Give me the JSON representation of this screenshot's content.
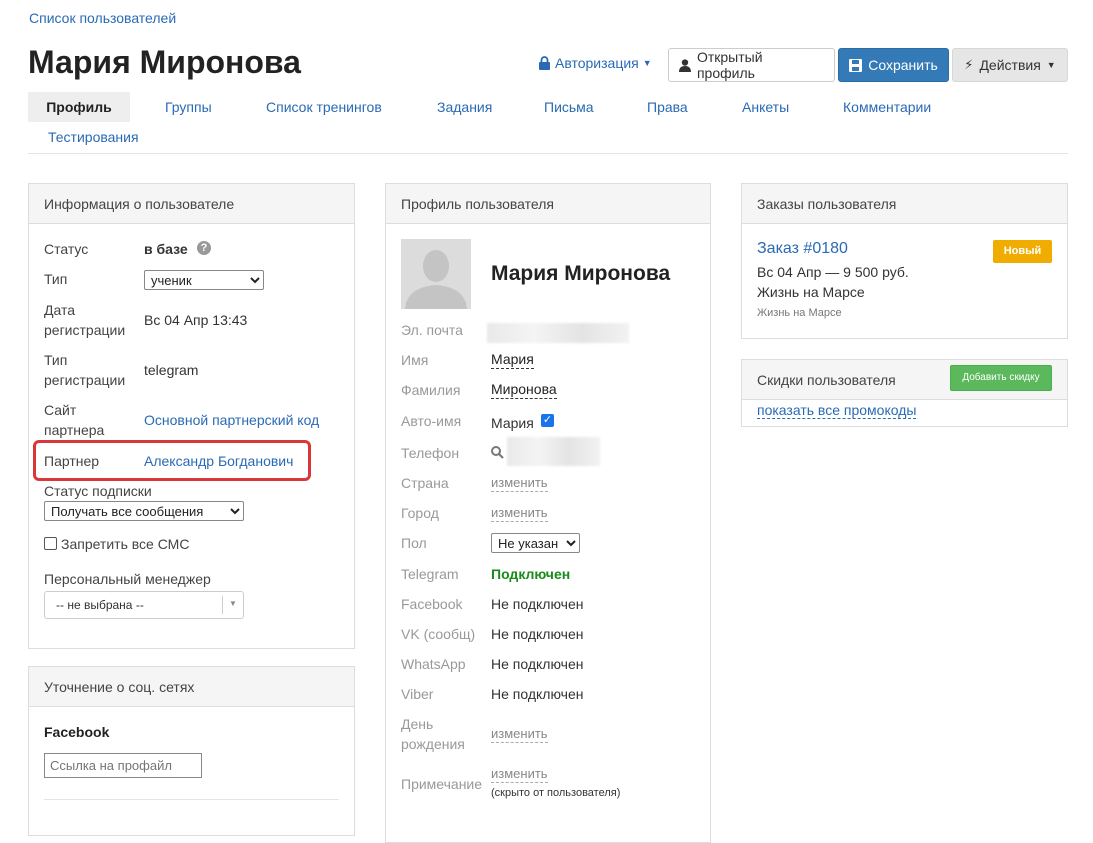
{
  "breadcrumb": "Список пользователей",
  "title": "Мария Миронова",
  "header": {
    "auth_label": "Авторизация",
    "open_profile_label": "Открытый профиль",
    "save_label": "Сохранить",
    "actions_label": "Действия"
  },
  "tabs": [
    "Профиль",
    "Группы",
    "Список тренингов",
    "Задания",
    "Письма",
    "Права",
    "Анкеты",
    "Комментарии",
    "Тестирования"
  ],
  "user_info": {
    "heading": "Информация о пользователе",
    "status_label": "Статус",
    "status_value": "в базе",
    "type_label": "Тип",
    "type_value": "ученик",
    "reg_date_label_1": "Дата",
    "reg_date_label_2": "регистрации",
    "reg_date_value": "Вс 04 Апр 13:43",
    "reg_type_label_1": "Тип",
    "reg_type_label_2": "регистрации",
    "reg_type_value": "telegram",
    "partner_site_label_1": "Сайт",
    "partner_site_label_2": "партнера",
    "partner_site_value": "Основной партнерский код",
    "partner_label": "Партнер",
    "partner_value": "Александр Богданович",
    "subscription_label": "Статус подписки",
    "subscription_value": "Получать все сообщения",
    "sms_label": "Запретить все СМС",
    "manager_label": "Персональный менеджер",
    "manager_value": "-- не выбрана --"
  },
  "social": {
    "heading": "Уточнение о соц. сетях",
    "facebook_label": "Facebook",
    "profile_link_placeholder": "Ссылка на профайл"
  },
  "profile": {
    "heading": "Профиль пользователя",
    "name": "Мария Миронова",
    "email_label": "Эл. почта",
    "first_name_label": "Имя",
    "first_name_value": "Мария",
    "last_name_label": "Фамилия",
    "last_name_value": "Миронова",
    "auto_name_label": "Авто-имя",
    "auto_name_value": "Мария",
    "phone_label": "Телефон",
    "country_label": "Страна",
    "city_label": "Город",
    "change_label": "изменить",
    "gender_label": "Пол",
    "gender_value": "Не указан",
    "telegram_label": "Telegram",
    "telegram_value": "Подключен",
    "facebook_label": "Facebook",
    "vk_label": "VK (сообщ)",
    "whatsapp_label": "WhatsApp",
    "viber_label": "Viber",
    "not_connected": "Не подключен",
    "birthday_label_1": "День",
    "birthday_label_2": "рождения",
    "note_label": "Примечание",
    "note_hint": "(скрыто от пользователя)"
  },
  "orders": {
    "heading": "Заказы пользователя",
    "order_title": "Заказ #0180",
    "badge": "Новый",
    "order_line": "Вс 04 Апр — 9 500 руб.",
    "product": "Жизнь на Марсе",
    "product_small": "Жизнь на Марсе"
  },
  "discounts": {
    "heading": "Скидки пользователя",
    "add_button": "Добавить скидку",
    "show_promos": "показать все промокоды"
  },
  "colors": {
    "primary": "#337ab7",
    "link": "#2a6ab5",
    "badge": "#f0ad00",
    "success": "#5cb85c",
    "connected": "#1a8a1a",
    "highlight": "#d9383a"
  }
}
